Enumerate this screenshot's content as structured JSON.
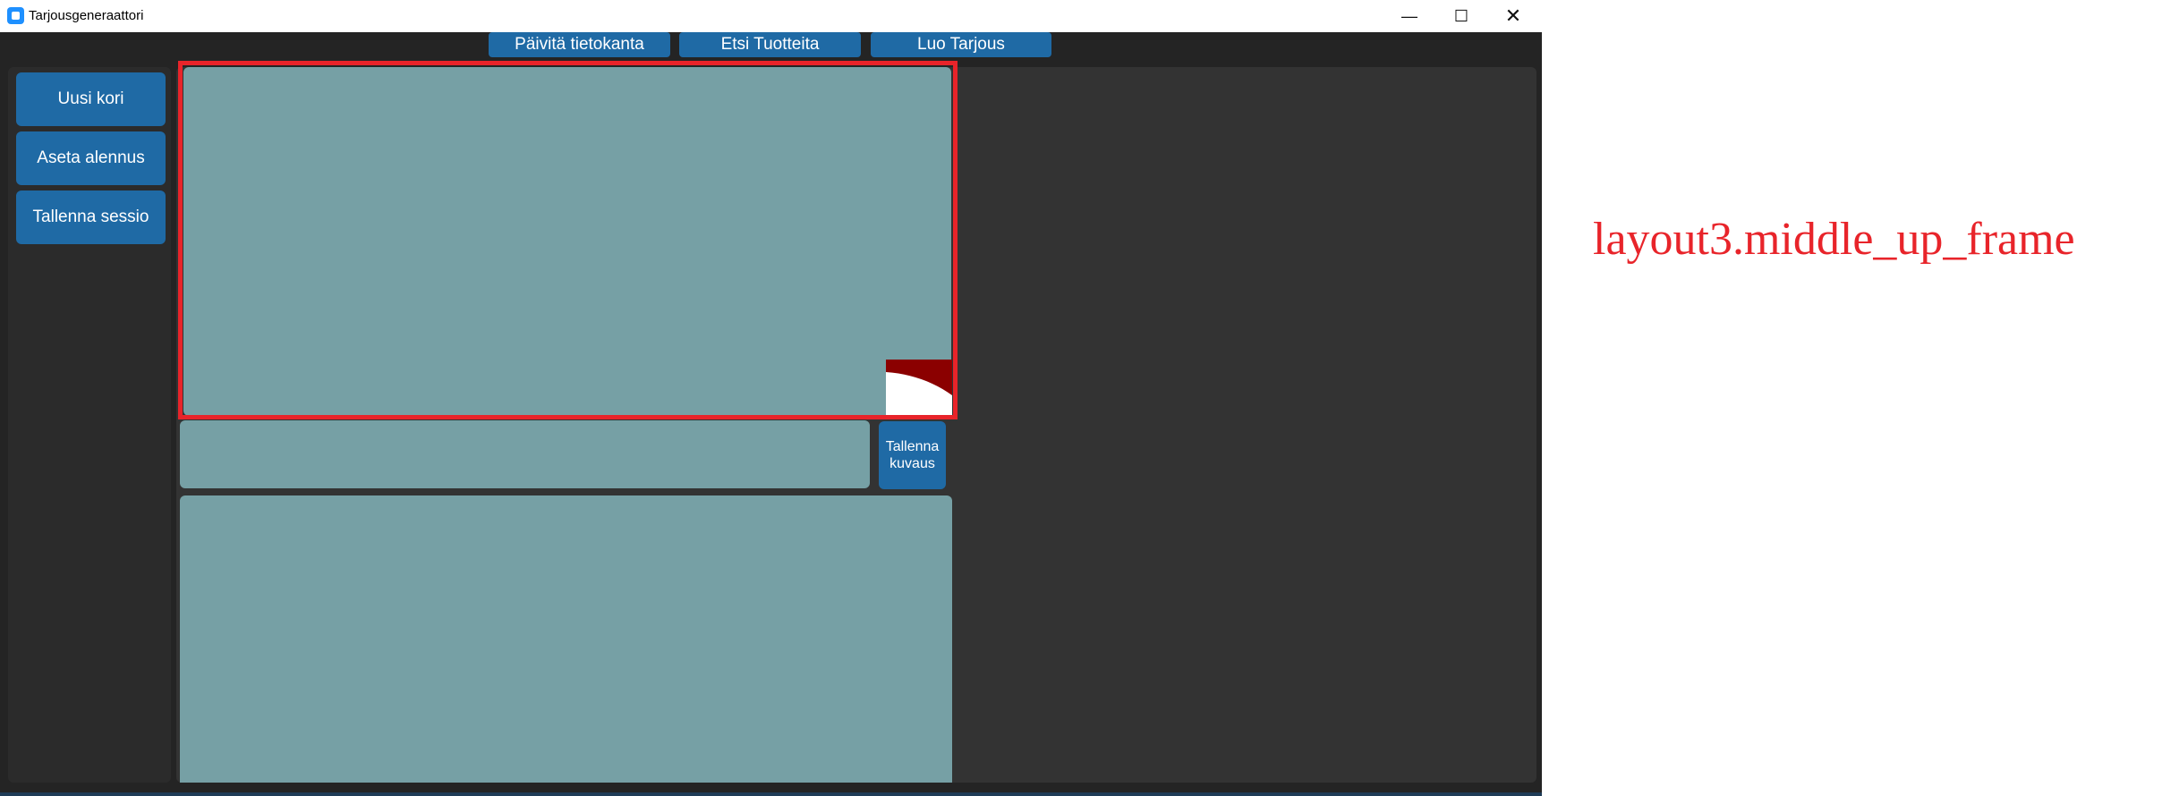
{
  "window": {
    "title": "Tarjousgeneraattori",
    "controls": {
      "minimize": "—",
      "maximize": "☐",
      "close": "✕"
    }
  },
  "top_buttons": [
    "Päivitä tietokanta",
    "Etsi Tuotteita",
    "Luo Tarjous"
  ],
  "sidebar": {
    "buttons": [
      "Uusi kori",
      "Aseta alennus",
      "Tallenna sessio"
    ]
  },
  "middle": {
    "save_description_button": "Tallenna\nkuvaus"
  },
  "annotation": {
    "label": "layout3.middle_up_frame"
  },
  "colors": {
    "accent": "#1f6aa5",
    "frame": "#76a0a5",
    "highlight": "#e8242a",
    "background": "#242424"
  }
}
